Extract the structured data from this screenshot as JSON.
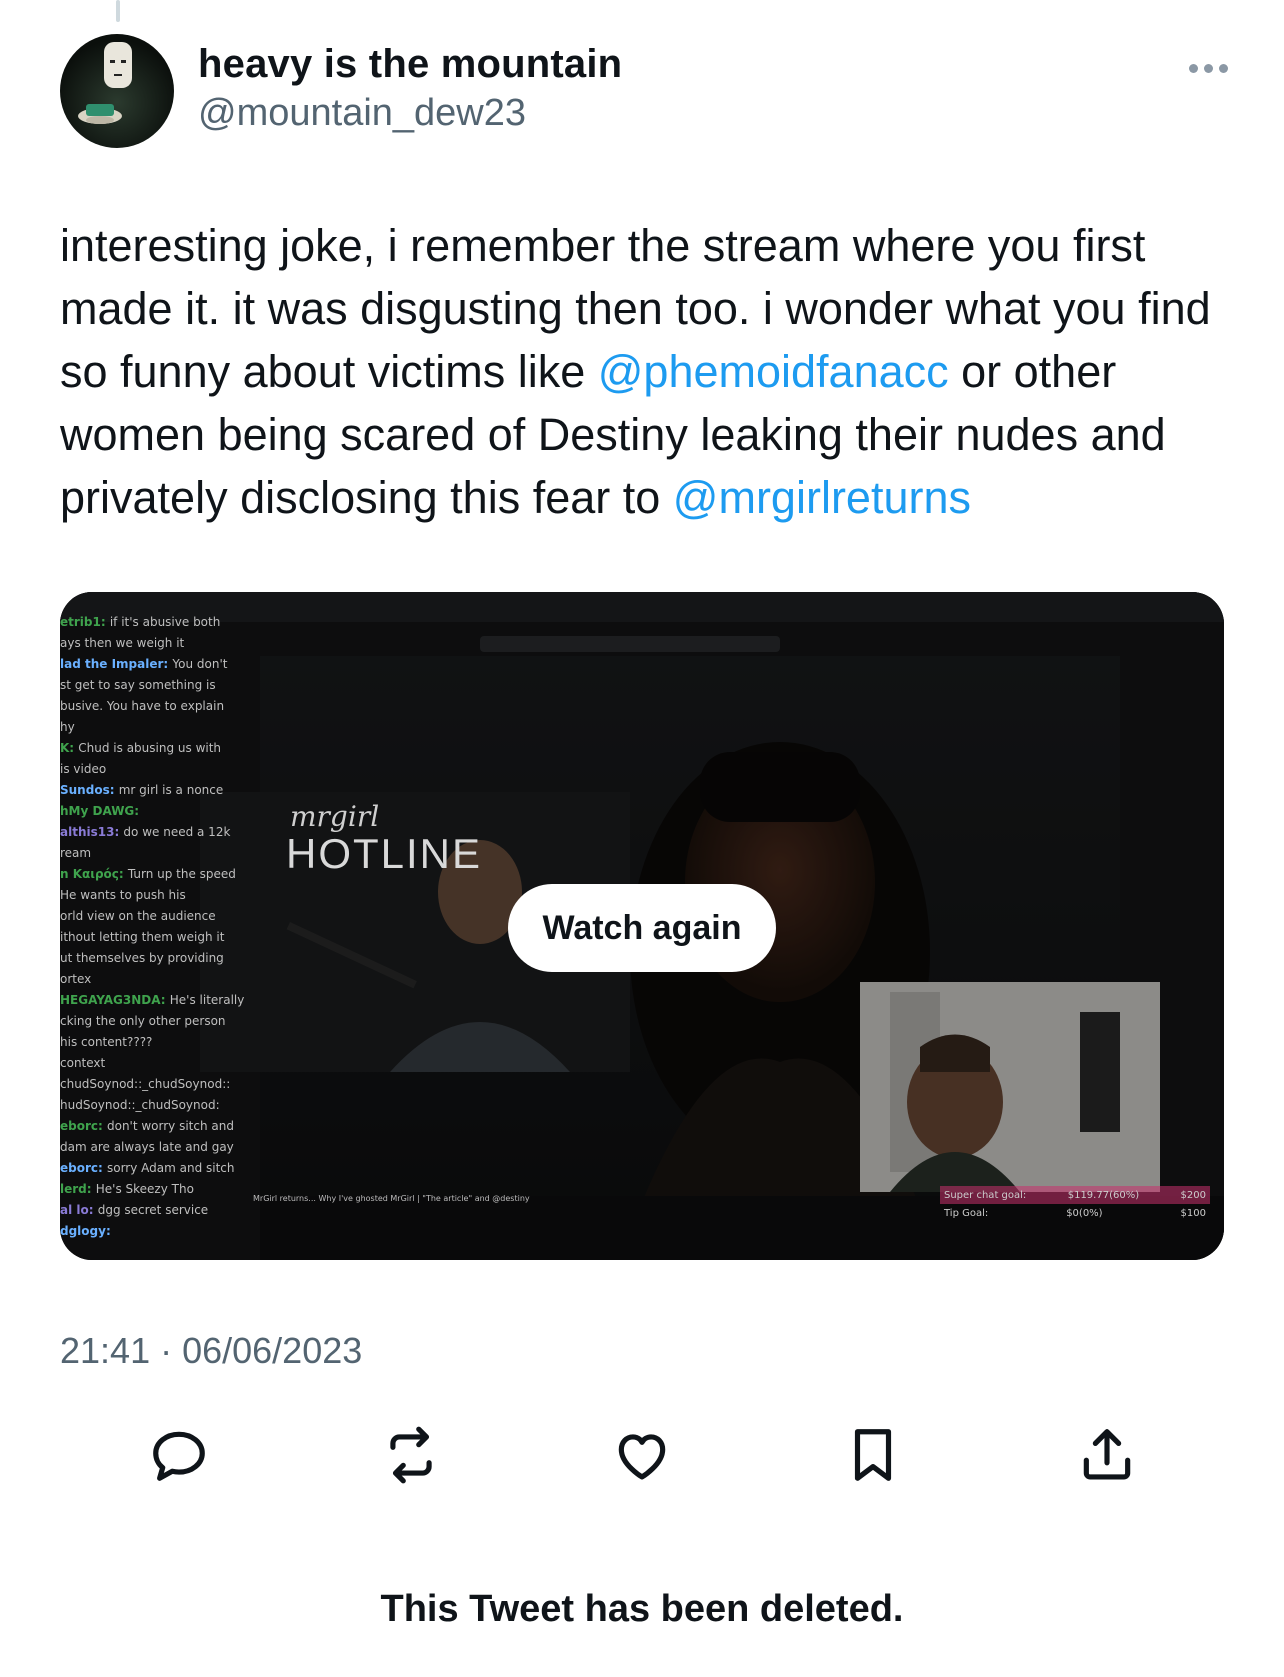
{
  "tweet": {
    "author_name": "heavy is the mountain",
    "author_handle": "@mountain_dew23",
    "text_parts": {
      "p1": "interesting joke, i remember the stream where you first made it. it was disgusting then too. i wonder what you find so funny about victims like ",
      "mention1": "@phemoidfanacc",
      "p2": " or other women being scared of Destiny leaking their nudes and privately disclosing this fear to ",
      "mention2": "@mrgirlreturns"
    },
    "timestamp": "21:41 · 06/06/2023"
  },
  "media": {
    "watch_again_label": "Watch again",
    "overlay_script": "mrgirl",
    "overlay_title": "HOTLINE",
    "video_title": "MrGirl returns... Why I've ghosted MrGirl | \"The article\" and @destiny",
    "goal": {
      "super_chat_label": "Super chat goal:",
      "super_chat_value": "$119.77(60%)",
      "super_chat_target": "$200",
      "tip_label": "Tip Goal:",
      "tip_value": "$0(0%)",
      "tip_target": "$100"
    },
    "chat": [
      {
        "user": "etrib1",
        "msg": "if it's abusive both"
      },
      {
        "user": "",
        "msg": "ays then we weigh it"
      },
      {
        "user": "lad the Impaler",
        "msg": "You don't"
      },
      {
        "user": "",
        "msg": "st get to say something is"
      },
      {
        "user": "",
        "msg": "busive. You have to explain"
      },
      {
        "user": "",
        "msg": "hy"
      },
      {
        "user": "K",
        "msg": "Chud is abusing us with"
      },
      {
        "user": "",
        "msg": "is video"
      },
      {
        "user": "Sundos",
        "msg": "mr girl is a nonce"
      },
      {
        "user": "hMy DAWG",
        "msg": ""
      },
      {
        "user": "althis13",
        "msg": "do we need a 12k"
      },
      {
        "user": "",
        "msg": "ream"
      },
      {
        "user": "n Καιρός",
        "msg": "Turn up the speed"
      },
      {
        "user": "",
        "msg": "He wants to push his"
      },
      {
        "user": "",
        "msg": "orld view on the audience"
      },
      {
        "user": "",
        "msg": "ithout letting them weigh it"
      },
      {
        "user": "",
        "msg": "ut themselves by providing"
      },
      {
        "user": "",
        "msg": "ortex"
      },
      {
        "user": "HEGAYAG3NDA",
        "msg": "He's literally"
      },
      {
        "user": "",
        "msg": "cking the only other person"
      },
      {
        "user": "",
        "msg": "his content????"
      },
      {
        "user": "",
        "msg": "context"
      },
      {
        "user": "",
        "msg": "chudSoynod::_chudSoynod::"
      },
      {
        "user": "",
        "msg": "hudSoynod::_chudSoynod:"
      },
      {
        "user": "eborc",
        "msg": "don't worry sitch and"
      },
      {
        "user": "",
        "msg": "dam are always late and gay"
      },
      {
        "user": "eborc",
        "msg": "sorry Adam and sitch"
      },
      {
        "user": "lerd",
        "msg": "He's Skeezy Tho"
      },
      {
        "user": "al lo",
        "msg": "dgg secret service"
      },
      {
        "user": "dglogy",
        "msg": ""
      }
    ]
  },
  "actions": {
    "reply_icon": "reply-icon",
    "retweet_icon": "retweet-icon",
    "like_icon": "heart-icon",
    "bookmark_icon": "bookmark-icon",
    "share_icon": "share-icon"
  },
  "footer": {
    "deleted_notice": "This Tweet has been deleted."
  },
  "colors": {
    "text": "#0f1419",
    "secondary": "#536471",
    "link": "#1d9bf0"
  }
}
